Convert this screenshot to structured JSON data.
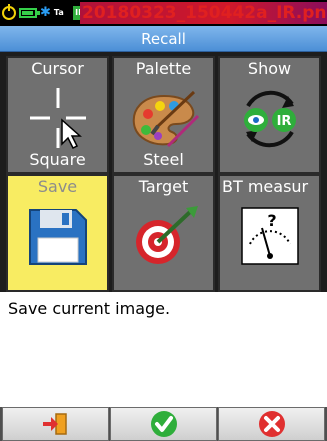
{
  "status_bar": {
    "icons": [
      "power-icon",
      "battery-icon",
      "bluetooth-icon",
      "ta-icon",
      "ir-icon"
    ],
    "bluetooth_glyph": "✱",
    "ta_text": "Ta",
    "ir_text": "IR",
    "filename": "20180323_150442a_IR.png"
  },
  "title": "Recall",
  "tiles": [
    {
      "id": "cursor",
      "label": "Cursor",
      "value": "Square",
      "icon": "cursor-crosshair-icon"
    },
    {
      "id": "palette",
      "label": "Palette",
      "value": "Steel",
      "icon": "palette-icon"
    },
    {
      "id": "show",
      "label": "Show",
      "value": "",
      "icon": "visible-ir-swap-icon",
      "ir_text": "IR"
    },
    {
      "id": "save",
      "label": "Save",
      "value": "",
      "icon": "floppy-disk-icon",
      "selected": true
    },
    {
      "id": "target",
      "label": "Target",
      "value": "",
      "icon": "target-dart-icon"
    },
    {
      "id": "bt_measure",
      "label": "BT measur",
      "value": "",
      "icon": "meter-gauge-icon",
      "gauge_text": "?"
    }
  ],
  "description": "Save current image.",
  "toolbar": {
    "buttons": [
      {
        "name": "exit",
        "icon": "exit-icon"
      },
      {
        "name": "confirm",
        "icon": "check-icon"
      },
      {
        "name": "cancel",
        "icon": "cancel-icon"
      }
    ]
  },
  "colors": {
    "title_bar": "#5a9ae0",
    "tile_bg": "#707070",
    "tile_selected": "#f8ec62",
    "filename_bg": "#c0152e",
    "confirm_green": "#2fae3b",
    "cancel_red": "#e03030"
  }
}
